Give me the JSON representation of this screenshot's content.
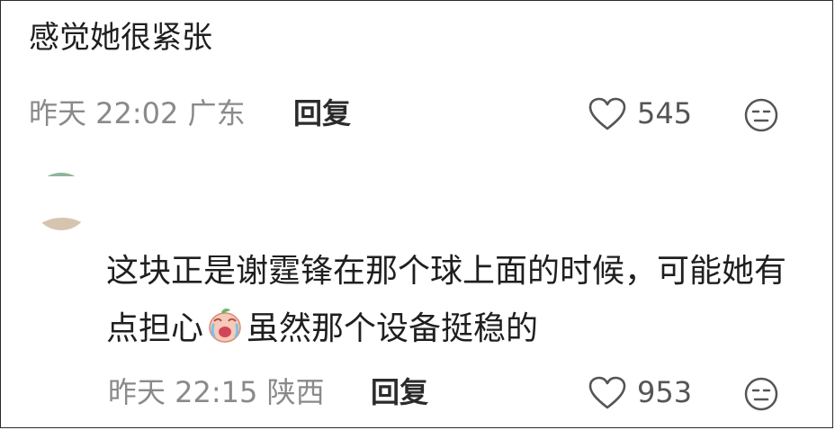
{
  "comments": [
    {
      "text": "感觉她很紧张",
      "time": "昨天 22:02",
      "location": "广东",
      "reply_label": "回复",
      "likes": "545"
    },
    {
      "text_part1": "这块正是谢霆锋在那个球上面的时候，可能她有点担心",
      "text_part2": "虽然那个设备挺稳的",
      "time": "昨天 22:15",
      "location": "陕西",
      "reply_label": "回复",
      "likes": "953"
    }
  ],
  "icons": {
    "like": "heart-outline-icon",
    "react": "neutral-face-icon",
    "sticker": "crying-peach-sticker"
  }
}
